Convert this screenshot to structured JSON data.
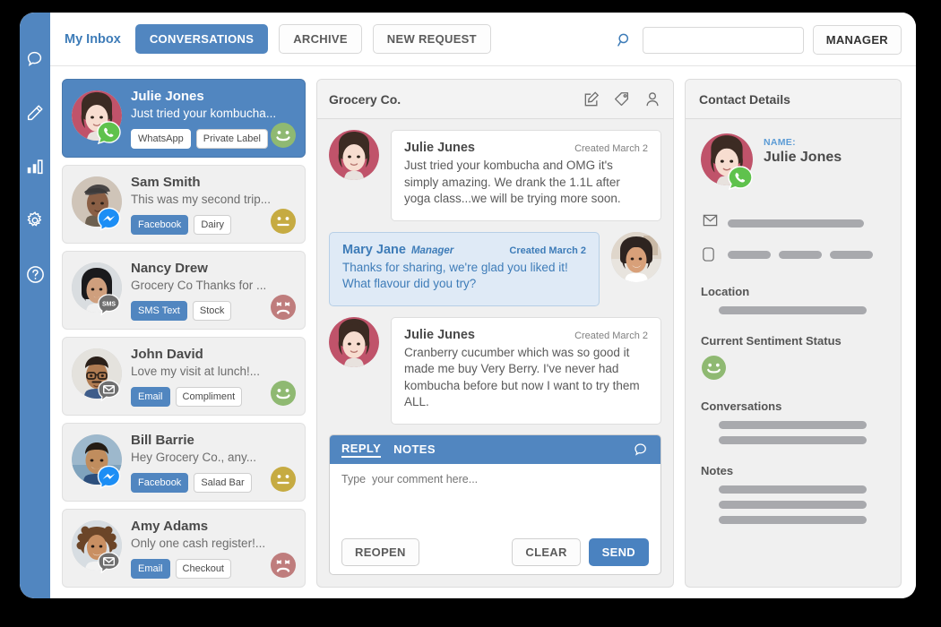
{
  "rail": {
    "items": [
      {
        "icon": "chat-bubble-icon",
        "name": "rail-item-conversations"
      },
      {
        "icon": "pencil-icon",
        "name": "rail-item-compose"
      },
      {
        "icon": "bar-chart-icon",
        "name": "rail-item-analytics"
      },
      {
        "icon": "gear-icon",
        "name": "rail-item-settings"
      },
      {
        "icon": "help-circle-icon",
        "name": "rail-item-help"
      }
    ]
  },
  "topbar": {
    "my_inbox": "My Inbox",
    "tabs": [
      {
        "label": "CONVERSATIONS",
        "active": true
      },
      {
        "label": "ARCHIVE",
        "active": false
      },
      {
        "label": "NEW REQUEST",
        "active": false
      }
    ],
    "search": {
      "value": "",
      "placeholder": ""
    },
    "manager_label": "MANAGER",
    "search_icon": "search-icon"
  },
  "conversations": [
    {
      "name": "Julie Jones",
      "snippet": "Just tried your kombucha...",
      "channel_tag": "WhatsApp",
      "topic_tag": "Private Label",
      "badge": "whatsapp-icon",
      "mood": "happy",
      "mood_color": "#8fb972",
      "selected": true
    },
    {
      "name": "Sam Smith",
      "snippet": "This was my second trip...",
      "channel_tag": "Facebook",
      "topic_tag": "Dairy",
      "badge": "messenger-icon",
      "mood": "neutral",
      "mood_color": "#c6ab42",
      "selected": false
    },
    {
      "name": "Nancy Drew",
      "snippet": "Grocery Co Thanks for ...",
      "channel_tag": "SMS Text",
      "topic_tag": "Stock",
      "badge": "sms-icon",
      "mood": "sad",
      "mood_color": "#bf7d7d",
      "selected": false
    },
    {
      "name": "John David",
      "snippet": "Love my visit at lunch!...",
      "channel_tag": "Email",
      "topic_tag": "Compliment",
      "badge": "email-icon",
      "mood": "happy",
      "mood_color": "#8fb972",
      "selected": false
    },
    {
      "name": "Bill Barrie",
      "snippet": "Hey Grocery Co., any...",
      "channel_tag": "Facebook",
      "topic_tag": "Salad Bar",
      "badge": "messenger-icon",
      "mood": "neutral",
      "mood_color": "#c6ab42",
      "selected": false
    },
    {
      "name": "Amy Adams",
      "snippet": "Only one cash register!...",
      "channel_tag": "Email",
      "topic_tag": "Checkout",
      "badge": "email-icon",
      "mood": "sad",
      "mood_color": "#bf7d7d",
      "selected": false
    }
  ],
  "center": {
    "title": "Grocery Co.",
    "header_icons": [
      "compose-icon",
      "tag-icon",
      "person-icon"
    ],
    "messages": [
      {
        "author": "Julie Junes",
        "role": "",
        "date": "Created March 2",
        "text": "Just tried your kombucha and OMG it's simply amazing. We drank the 1.1L after yoga class...we will be trying more soon.",
        "side": "customer"
      },
      {
        "author": "Mary Jane",
        "role": "Manager",
        "date": "Created March 2",
        "text": "Thanks for sharing, we're glad you liked it! What flavour did you try?",
        "side": "agent"
      },
      {
        "author": "Julie Junes",
        "role": "",
        "date": "Created March 2",
        "text": "Cranberry cucumber which was so good it made me buy Very Berry. I've never had kombucha before but now I want to try them ALL.",
        "side": "customer"
      }
    ],
    "reply": {
      "tabs": [
        {
          "label": "REPLY",
          "active": true
        },
        {
          "label": "NOTES",
          "active": false
        }
      ],
      "bubble_icon": "chat-bubble-icon",
      "textarea_value": "",
      "textarea_placeholder": "Type  your comment here...",
      "reopen_label": "REOPEN",
      "clear_label": "CLEAR",
      "send_label": "SEND"
    }
  },
  "contact": {
    "title": "Contact Details",
    "name_label": "NAME:",
    "name_value": "Julie Jones",
    "badge": "whatsapp-icon",
    "rows": [
      {
        "icon": "envelope-icon",
        "bars": [
          1
        ]
      },
      {
        "icon": "mobile-icon",
        "bars": [
          3
        ]
      }
    ],
    "sections": [
      {
        "label": "Location",
        "bars": 1
      },
      {
        "label": "Current Sentiment Status",
        "mood": "happy",
        "mood_color": "#8fb972"
      },
      {
        "label": "Conversations",
        "bars": 2
      },
      {
        "label": "Notes",
        "bars": 3
      }
    ]
  },
  "colors": {
    "accent_blue": "#5186c0",
    "link_blue": "#3e7cb8",
    "happy": "#8fb972",
    "neutral": "#c6ab42",
    "sad": "#bf7d7d",
    "panel_bg": "#f0f0f0"
  }
}
